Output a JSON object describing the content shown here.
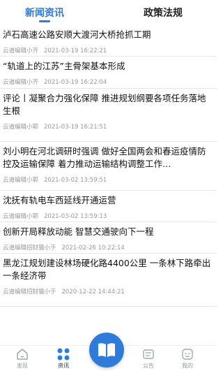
{
  "tabs": [
    {
      "label": "新闻资讯",
      "active": true
    },
    {
      "label": "政策法规",
      "active": false
    }
  ],
  "news": [
    {
      "title": "泸石高速公路安顺大渡河大桥抢抓工期",
      "author": "云道编辑小齐",
      "time": "2021-03-19 16:22:21"
    },
    {
      "title": "“轨道上的江苏”主骨架基本形成",
      "author": "云道编辑小齐",
      "time": "2021-03-19 16:22:04"
    },
    {
      "title": "评论丨凝聚合力强化保障 推进规划纲要各项任务落地生根",
      "author": "云道编辑小郭",
      "time": "2021-03-19 16:21:51"
    },
    {
      "title": "刘小明在河北调研时强调 做好全国两会和春运疫情防控及运输保障 着力推动运输结构调整工作…",
      "author": "云道编辑小郭",
      "time": "2021-03-02 13:59:51"
    },
    {
      "title": "沈抚有轨电车西延线开通运营",
      "author": "云道编辑小郭",
      "time": "2021-03-02 13:59:13"
    },
    {
      "title": "创新开局释放动能 智慧交通驶向下一程",
      "author": "云道编辑招财猫小于",
      "time": "2021-02-26 10:22:14"
    },
    {
      "title": "黑龙江规划建设林场硬化路4400公里 一条林下路牵出一条经济带",
      "author": "云道编辑招财猫小于",
      "time": "2020-12-22 14:44:21"
    }
  ],
  "bottom_nav": [
    {
      "label": "发现",
      "icon": "home-icon"
    },
    {
      "label": "资讯",
      "icon": "grid-icon",
      "active": true
    },
    {
      "label": "",
      "icon": "book-icon"
    },
    {
      "label": "公告",
      "icon": "notice-icon"
    },
    {
      "label": "我的",
      "icon": "profile-icon"
    }
  ],
  "colors": {
    "accent": "#2f7bd9"
  }
}
